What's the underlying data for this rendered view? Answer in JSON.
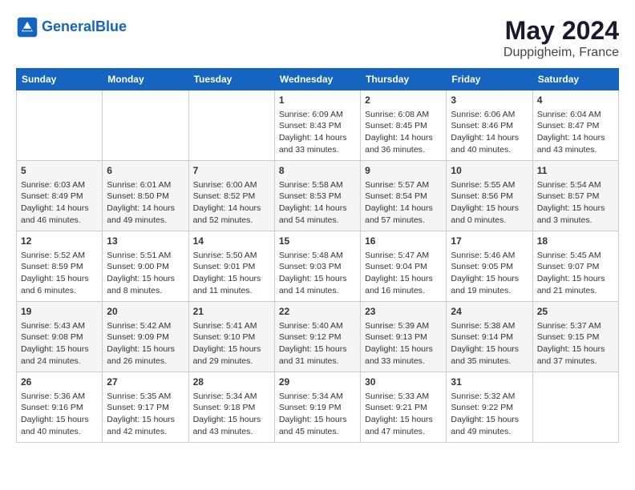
{
  "header": {
    "logo_general": "General",
    "logo_blue": "Blue",
    "month": "May 2024",
    "location": "Duppigheim, France"
  },
  "weekdays": [
    "Sunday",
    "Monday",
    "Tuesday",
    "Wednesday",
    "Thursday",
    "Friday",
    "Saturday"
  ],
  "weeks": [
    [
      {
        "day": "",
        "info": ""
      },
      {
        "day": "",
        "info": ""
      },
      {
        "day": "",
        "info": ""
      },
      {
        "day": "1",
        "info": "Sunrise: 6:09 AM\nSunset: 8:43 PM\nDaylight: 14 hours\nand 33 minutes."
      },
      {
        "day": "2",
        "info": "Sunrise: 6:08 AM\nSunset: 8:45 PM\nDaylight: 14 hours\nand 36 minutes."
      },
      {
        "day": "3",
        "info": "Sunrise: 6:06 AM\nSunset: 8:46 PM\nDaylight: 14 hours\nand 40 minutes."
      },
      {
        "day": "4",
        "info": "Sunrise: 6:04 AM\nSunset: 8:47 PM\nDaylight: 14 hours\nand 43 minutes."
      }
    ],
    [
      {
        "day": "5",
        "info": "Sunrise: 6:03 AM\nSunset: 8:49 PM\nDaylight: 14 hours\nand 46 minutes."
      },
      {
        "day": "6",
        "info": "Sunrise: 6:01 AM\nSunset: 8:50 PM\nDaylight: 14 hours\nand 49 minutes."
      },
      {
        "day": "7",
        "info": "Sunrise: 6:00 AM\nSunset: 8:52 PM\nDaylight: 14 hours\nand 52 minutes."
      },
      {
        "day": "8",
        "info": "Sunrise: 5:58 AM\nSunset: 8:53 PM\nDaylight: 14 hours\nand 54 minutes."
      },
      {
        "day": "9",
        "info": "Sunrise: 5:57 AM\nSunset: 8:54 PM\nDaylight: 14 hours\nand 57 minutes."
      },
      {
        "day": "10",
        "info": "Sunrise: 5:55 AM\nSunset: 8:56 PM\nDaylight: 15 hours\nand 0 minutes."
      },
      {
        "day": "11",
        "info": "Sunrise: 5:54 AM\nSunset: 8:57 PM\nDaylight: 15 hours\nand 3 minutes."
      }
    ],
    [
      {
        "day": "12",
        "info": "Sunrise: 5:52 AM\nSunset: 8:59 PM\nDaylight: 15 hours\nand 6 minutes."
      },
      {
        "day": "13",
        "info": "Sunrise: 5:51 AM\nSunset: 9:00 PM\nDaylight: 15 hours\nand 8 minutes."
      },
      {
        "day": "14",
        "info": "Sunrise: 5:50 AM\nSunset: 9:01 PM\nDaylight: 15 hours\nand 11 minutes."
      },
      {
        "day": "15",
        "info": "Sunrise: 5:48 AM\nSunset: 9:03 PM\nDaylight: 15 hours\nand 14 minutes."
      },
      {
        "day": "16",
        "info": "Sunrise: 5:47 AM\nSunset: 9:04 PM\nDaylight: 15 hours\nand 16 minutes."
      },
      {
        "day": "17",
        "info": "Sunrise: 5:46 AM\nSunset: 9:05 PM\nDaylight: 15 hours\nand 19 minutes."
      },
      {
        "day": "18",
        "info": "Sunrise: 5:45 AM\nSunset: 9:07 PM\nDaylight: 15 hours\nand 21 minutes."
      }
    ],
    [
      {
        "day": "19",
        "info": "Sunrise: 5:43 AM\nSunset: 9:08 PM\nDaylight: 15 hours\nand 24 minutes."
      },
      {
        "day": "20",
        "info": "Sunrise: 5:42 AM\nSunset: 9:09 PM\nDaylight: 15 hours\nand 26 minutes."
      },
      {
        "day": "21",
        "info": "Sunrise: 5:41 AM\nSunset: 9:10 PM\nDaylight: 15 hours\nand 29 minutes."
      },
      {
        "day": "22",
        "info": "Sunrise: 5:40 AM\nSunset: 9:12 PM\nDaylight: 15 hours\nand 31 minutes."
      },
      {
        "day": "23",
        "info": "Sunrise: 5:39 AM\nSunset: 9:13 PM\nDaylight: 15 hours\nand 33 minutes."
      },
      {
        "day": "24",
        "info": "Sunrise: 5:38 AM\nSunset: 9:14 PM\nDaylight: 15 hours\nand 35 minutes."
      },
      {
        "day": "25",
        "info": "Sunrise: 5:37 AM\nSunset: 9:15 PM\nDaylight: 15 hours\nand 37 minutes."
      }
    ],
    [
      {
        "day": "26",
        "info": "Sunrise: 5:36 AM\nSunset: 9:16 PM\nDaylight: 15 hours\nand 40 minutes."
      },
      {
        "day": "27",
        "info": "Sunrise: 5:35 AM\nSunset: 9:17 PM\nDaylight: 15 hours\nand 42 minutes."
      },
      {
        "day": "28",
        "info": "Sunrise: 5:34 AM\nSunset: 9:18 PM\nDaylight: 15 hours\nand 43 minutes."
      },
      {
        "day": "29",
        "info": "Sunrise: 5:34 AM\nSunset: 9:19 PM\nDaylight: 15 hours\nand 45 minutes."
      },
      {
        "day": "30",
        "info": "Sunrise: 5:33 AM\nSunset: 9:21 PM\nDaylight: 15 hours\nand 47 minutes."
      },
      {
        "day": "31",
        "info": "Sunrise: 5:32 AM\nSunset: 9:22 PM\nDaylight: 15 hours\nand 49 minutes."
      },
      {
        "day": "",
        "info": ""
      }
    ]
  ]
}
